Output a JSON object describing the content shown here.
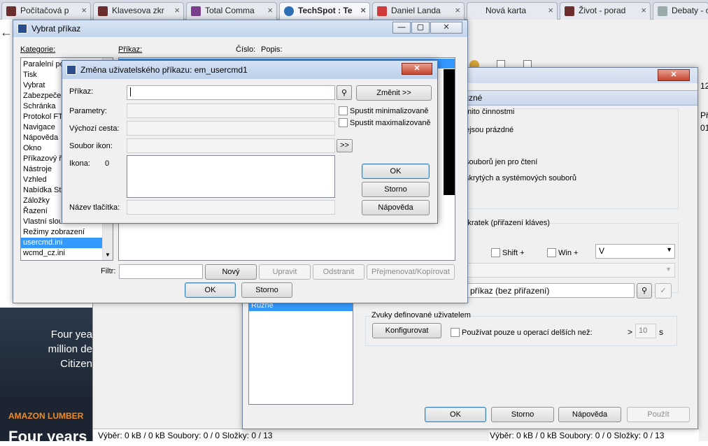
{
  "tabs": [
    {
      "label": "Počítačová p",
      "color": "#6b2d2d"
    },
    {
      "label": "Klavesova zkr",
      "color": "#6b2d2d"
    },
    {
      "label": "Total Comma",
      "color": "#7a3e8c"
    },
    {
      "label": "TechSpot : Te",
      "color": "#2d6fb5"
    },
    {
      "label": "Daniel Landa",
      "color": "#d23b3b"
    },
    {
      "label": "Nová karta",
      "color": "#e6e9ef"
    },
    {
      "label": "Život - porad",
      "color": "#6b2d2d"
    },
    {
      "label": "Debaty - com",
      "color": "#9aa"
    }
  ],
  "bg": {
    "promo_lines": [
      "Four yea",
      "million de",
      "Citizen"
    ],
    "amazon": "AMAZON LUMBER",
    "four_years": "Four years"
  },
  "status": {
    "left": "Výběr: 0 kB / 0 kB  Soubory: 0 / 0  Složky: 0 / 13",
    "right": "Výběr: 0 kB / 0 kB  Soubory: 0 / 0  Složky: 0 / 13"
  },
  "options": {
    "section": "Různé",
    "line1": "mito činnostmi",
    "line2": "ejsou prázdné",
    "line3": "souborů jen pro čtení",
    "line4": "skrytých a systémových souborů",
    "hotkeys_group": "zkratek (přiřazení kláves)",
    "shift": "Shift +",
    "win": "Win +",
    "key_value": "V",
    "command_value": "příkaz (bez přiřazení)",
    "list_item": "Různé",
    "sounds_group": "Zvuky definované uživatelem",
    "configure": "Konfigurovat",
    "only_longer": "Používat pouze u operací delších než:",
    "gt": ">",
    "seconds_value": "10",
    "s": "s",
    "ok": "OK",
    "cancel": "Storno",
    "help": "Nápověda",
    "apply": "Použít",
    "side_num": "12",
    "side_p": "Př",
    "side_01": "01"
  },
  "select_cmd": {
    "title": "Vybrat příkaz",
    "categories_label": "Kategorie:",
    "command_label": "Příkaz:",
    "number_label": "Číslo:",
    "desc_label": "Popis:",
    "categories": [
      "Paralelní po",
      "Tisk",
      "Vybrat",
      "Zabezpečen",
      "Schránka",
      "Protokol FT",
      "Navigace",
      "Nápověda",
      "Okno",
      "Příkazový ř",
      "Nástroje",
      "Vzhled",
      "Nabídka St",
      "Záložky",
      "Řazení",
      "Vlastní slou",
      "Režimy zobrazení",
      "usercmd.ini",
      "wcmd_cz.ini"
    ],
    "selected": "usercmd.ini",
    "filter_label": "Filtr:",
    "new": "Nový",
    "edit": "Upravit",
    "remove": "Odstranit",
    "rename": "Přejmenovat/Kopírovat",
    "ok": "OK",
    "cancel": "Storno"
  },
  "edit_cmd": {
    "title": "Změna uživatelského příkazu: em_usercmd1",
    "command_label": "Příkaz:",
    "params_label": "Parametry:",
    "startdir_label": "Výchozí cesta:",
    "iconfile_label": "Soubor ikon:",
    "icon_label": "Ikona:",
    "icon_index": "0",
    "tooltip_label": "Název tlačítka:",
    "change": "Změnit >>",
    "min": "Spustit minimalizovaně",
    "max": "Spustit maximalizovaně",
    "browse": ">>",
    "ok": "OK",
    "cancel": "Storno",
    "help": "Nápověda"
  }
}
